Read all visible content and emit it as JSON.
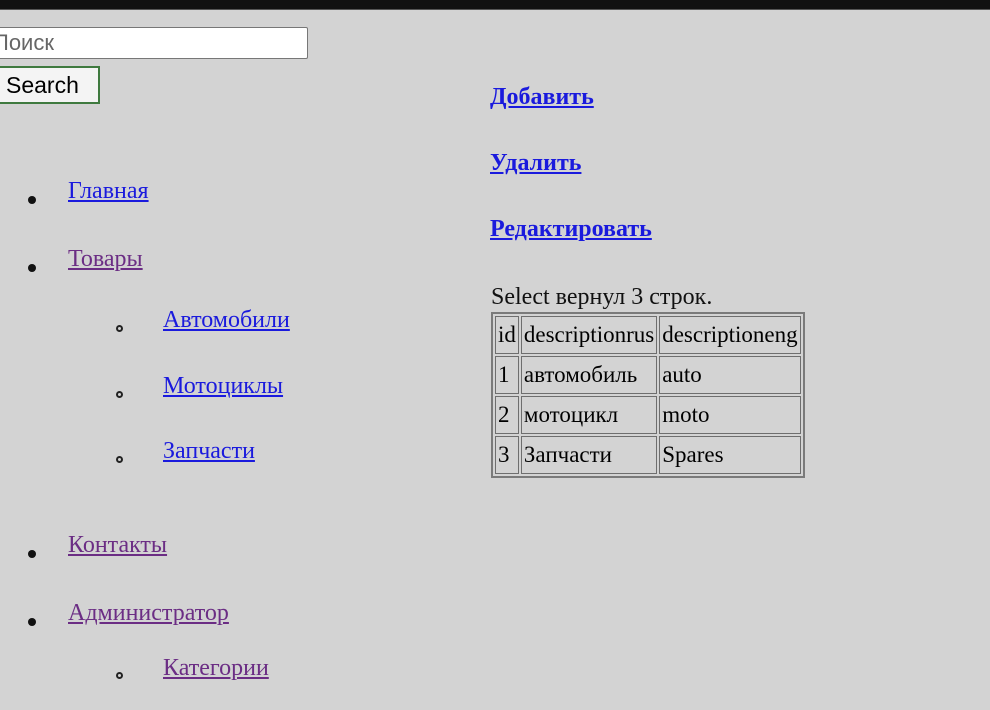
{
  "search": {
    "placeholder": "Поиск",
    "button_label": "Search"
  },
  "nav": {
    "items": [
      {
        "label": "Главная",
        "state": "unvisited"
      },
      {
        "label": "Товары",
        "state": "visited",
        "children": [
          {
            "label": "Автомобили",
            "state": "unvisited"
          },
          {
            "label": "Мотоциклы",
            "state": "unvisited"
          },
          {
            "label": "Запчасти",
            "state": "unvisited"
          }
        ]
      },
      {
        "label": "Контакты",
        "state": "visited"
      },
      {
        "label": "Администратор",
        "state": "visited",
        "children": [
          {
            "label": "Категории",
            "state": "visited"
          }
        ]
      }
    ]
  },
  "actions": {
    "add": "Добавить",
    "delete": "Удалить",
    "edit": "Редактировать"
  },
  "result": {
    "status": "Select вернул 3 строк.",
    "columns": [
      "id",
      "descriptionrus",
      "descriptioneng"
    ],
    "rows": [
      [
        "1",
        "автомобиль",
        "auto"
      ],
      [
        "2",
        "мотоцикл",
        "moto"
      ],
      [
        "3",
        "Запчасти",
        "Spares"
      ]
    ]
  },
  "colors": {
    "background": "#d3d3d3",
    "link_unvisited": "#1a1add",
    "link_visited": "#6b2d84",
    "button_border": "#3f7a3f"
  }
}
